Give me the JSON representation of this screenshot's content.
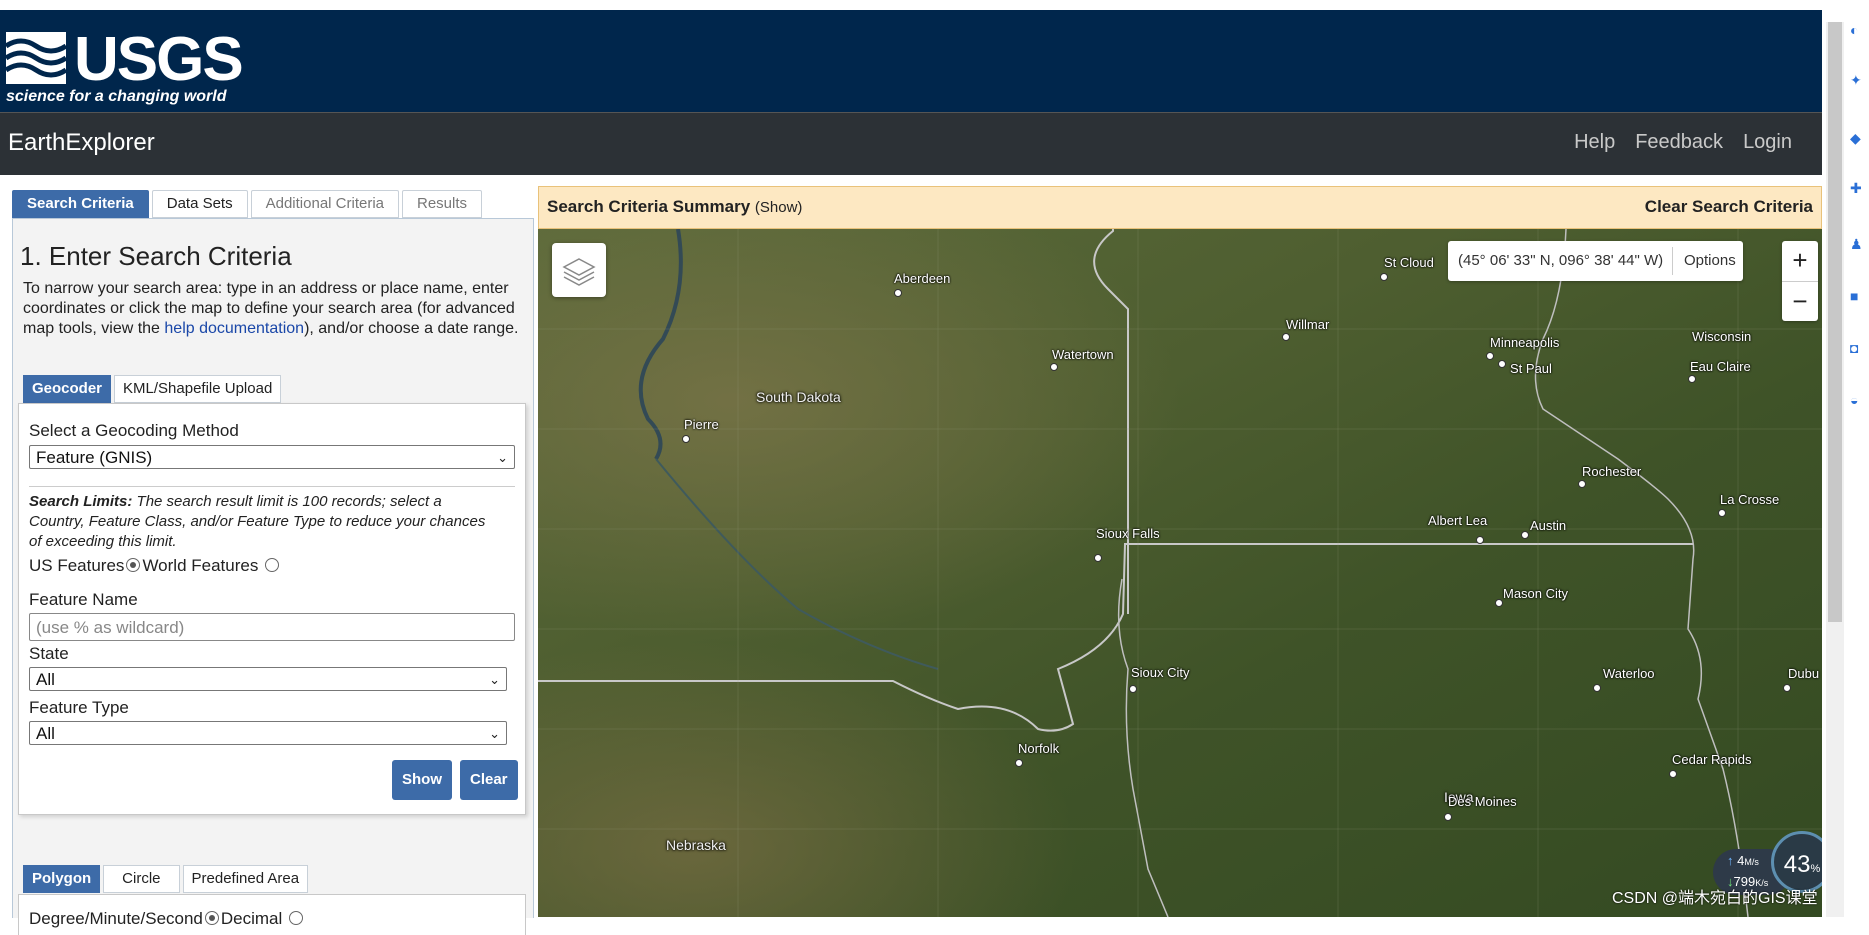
{
  "header": {
    "logo_word": "USGS",
    "logo_tagline": "science for a changing world",
    "app_title": "EarthExplorer",
    "nav": [
      "Help",
      "Feedback",
      "Login"
    ]
  },
  "main_tabs": [
    "Search Criteria",
    "Data Sets",
    "Additional Criteria",
    "Results"
  ],
  "search": {
    "step_title": "1. Enter Search Criteria",
    "intro_before": "To narrow your search area: type in an address or place name, enter coordinates or click the map to define your search area (for advanced map tools, view the ",
    "intro_link": "help documentation",
    "intro_after": "), and/or choose a date range.",
    "subtabs": [
      "Geocoder",
      "KML/Shapefile Upload"
    ],
    "geocoding_label": "Select a Geocoding Method",
    "geocoding_value": "Feature (GNIS)",
    "limits_bold": "Search Limits:",
    "limits_text": " The search result limit is 100 records; select a Country, Feature Class, and/or Feature Type to reduce your chances of exceeding this limit.",
    "us_features": "US Features",
    "world_features": "World Features",
    "feature_name_label": "Feature Name",
    "feature_name_placeholder": "(use % as wildcard)",
    "state_label": "State",
    "state_value": "All",
    "feature_type_label": "Feature Type",
    "feature_type_value": "All",
    "show_button": "Show",
    "clear_button": "Clear",
    "area_tabs": [
      "Polygon",
      "Circle",
      "Predefined Area"
    ],
    "dms_label": "Degree/Minute/Second",
    "decimal_label": "Decimal"
  },
  "summary": {
    "title": "Search Criteria Summary",
    "show": "(Show)",
    "clear": "Clear Search Criteria"
  },
  "map": {
    "coordinates": "(45° 06' 33\" N, 096° 38' 44\" W)",
    "options": "Options",
    "zoom_in": "+",
    "zoom_out": "−",
    "cities": [
      "Aberdeen",
      "St Cloud",
      "Willmar",
      "Watertown",
      "Minneapolis",
      "St Paul",
      "Wisconsin",
      "Eau Claire",
      "Pierre",
      "Rochester",
      "La Crosse",
      "Albert Lea",
      "Austin",
      "Sioux Falls",
      "Mason City",
      "Sioux City",
      "Waterloo",
      "Dubu",
      "Norfolk",
      "Cedar Rapids",
      "Des Moines"
    ],
    "states": [
      "South Dakota",
      "Iowa",
      "Nebraska"
    ]
  },
  "network_widget": {
    "upload": "4",
    "upload_unit": "M/s",
    "download": "799",
    "download_unit": "K/s",
    "percent": "43",
    "percent_unit": "%"
  },
  "watermark": "CSDN @端木宛白的GIS课堂"
}
